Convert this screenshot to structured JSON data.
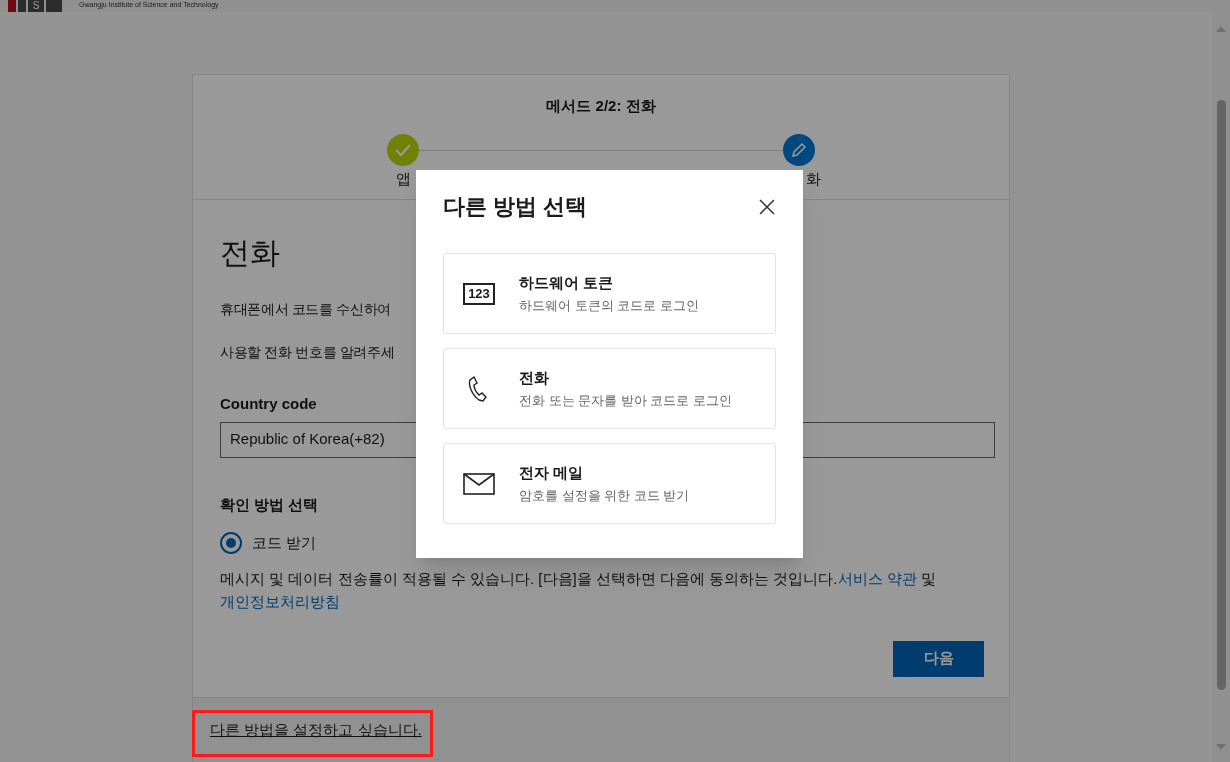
{
  "header": {
    "logo_letter": "S",
    "institution": "Gwangju Institute of Science and Technology"
  },
  "wizard": {
    "title": "메서드 2/2: 전화",
    "steps": [
      {
        "label": "앱",
        "done": true
      },
      {
        "label": "화",
        "done": false
      }
    ]
  },
  "page": {
    "heading": "전화",
    "intro": "휴대폰에서 코드를 수신하여",
    "prompt": "사용할 전화 번호를 알려주세",
    "country_label": "Country code",
    "country_value": "Republic of Korea(+82)",
    "method_label": "확인 방법 선택",
    "methods": [
      {
        "label": "코드 받기",
        "selected": true
      }
    ],
    "disclaimer": "메시지 및 데이터 전송률이 적용될 수 있습니다. [다음]을 선택하면 다음에 동의하는 것입니다.",
    "terms_link": "서비스 약관",
    "conjunction": "및",
    "privacy_link": "개인정보처리방침",
    "next_button": "다음"
  },
  "footer_link": "다른 방법을 설정하고 싶습니다.",
  "dialog": {
    "title": "다른 방법 선택",
    "options": [
      {
        "kind": "token",
        "badge": "123",
        "title": "하드웨어 토큰",
        "description": "하드웨어 토큰의 코드로 로그인"
      },
      {
        "kind": "phone",
        "title": "전화",
        "description": "전화 또는 문자를 받아 코드로 로그인"
      },
      {
        "kind": "email",
        "title": "전자 메일",
        "description": "암호를 설정을 위한 코드 받기"
      }
    ]
  }
}
